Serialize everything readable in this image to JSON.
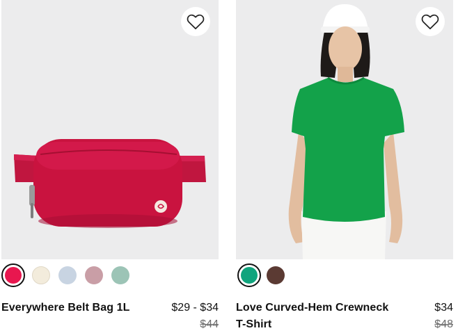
{
  "products": [
    {
      "name": "Everywhere Belt Bag 1L",
      "price": "$29 - $34",
      "original_price": "$44",
      "image_subject": "red belt bag",
      "swatches": [
        {
          "name": "red",
          "color": "#e8174f",
          "selected": true
        },
        {
          "name": "cream",
          "color": "#f3ecdc",
          "selected": false
        },
        {
          "name": "light-blue",
          "color": "#c8d4e2",
          "selected": false
        },
        {
          "name": "mauve",
          "color": "#c99ea6",
          "selected": false
        },
        {
          "name": "sage",
          "color": "#9cc4b6",
          "selected": false
        }
      ]
    },
    {
      "name": "Love Curved-Hem Crewneck T-Shirt",
      "price": "$34",
      "original_price": "$48",
      "image_subject": "model wearing green t-shirt",
      "swatches": [
        {
          "name": "green",
          "color": "#10a47d",
          "selected": true
        },
        {
          "name": "brown",
          "color": "#5b3a33",
          "selected": false
        }
      ]
    }
  ],
  "icons": {
    "wishlist": "heart-outline-icon"
  },
  "colors": {
    "image_background": "#ececed",
    "text": "#111111",
    "strike_price": "#6b6b6b"
  }
}
